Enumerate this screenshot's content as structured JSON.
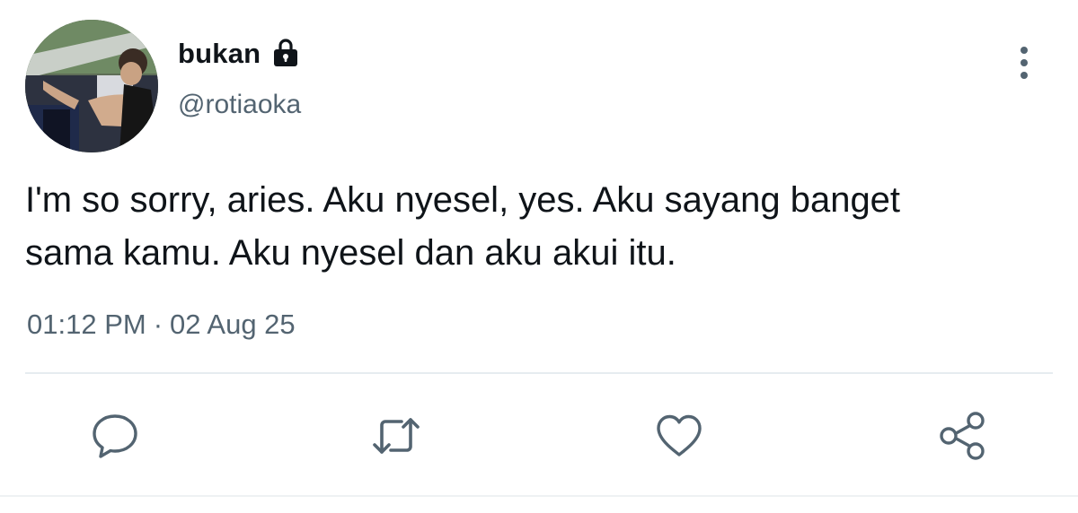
{
  "author": {
    "display_name": "bukan",
    "handle": "@rotiaoka",
    "protected_icon": "lock-icon",
    "avatar": "avatar"
  },
  "tweet": {
    "text": "I'm so sorry, aries. Aku nyesel, yes. Aku sayang banget\nsama kamu. Aku nyesel dan aku akui itu.",
    "time": "01:12 PM",
    "separator": "·",
    "date": "02 Aug 25"
  },
  "actions": [
    {
      "name": "reply",
      "icon": "speech-bubble-icon"
    },
    {
      "name": "retweet",
      "icon": "retweet-arrows-icon"
    },
    {
      "name": "like",
      "icon": "heart-icon"
    },
    {
      "name": "share",
      "icon": "share-nodes-icon"
    }
  ],
  "menu": {
    "icon": "vertical-dots-icon"
  },
  "colors": {
    "text": "#0f1419",
    "secondary": "#536471",
    "divider": "#e6ecf0"
  }
}
